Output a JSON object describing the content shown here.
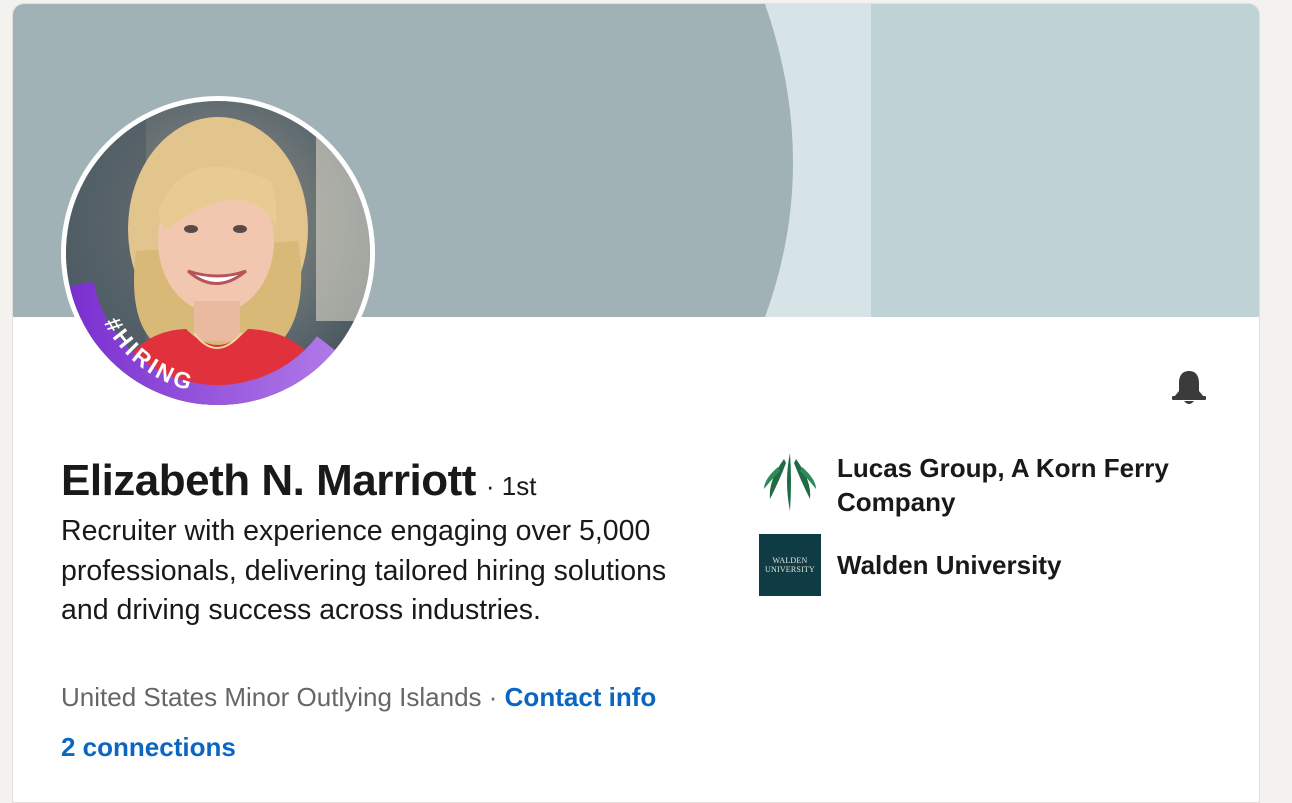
{
  "profile": {
    "name": "Elizabeth N. Marriott",
    "degree": "· 1st",
    "headline": "Recruiter with experience engaging over 5,000 professionals, delivering tailored hiring solutions and driving success across industries.",
    "location": "United States Minor Outlying Islands",
    "separator": " · ",
    "contact_info": "Contact info",
    "connections": "2 connections",
    "hiring_badge": "#HIRING"
  },
  "organizations": [
    {
      "name": "Lucas Group, A Korn Ferry Company",
      "logo_icon": "lucas-group-logo"
    },
    {
      "name": "Walden University",
      "logo_icon": "walden-university-logo",
      "logo_text": [
        "WALDEN",
        "UNIVERSITY"
      ]
    }
  ],
  "icons": {
    "bell": "bell-icon"
  },
  "colors": {
    "banner_dark": "#a0b2b6",
    "banner_mid": "#d7e4e7",
    "banner_light": "#bfd3d7",
    "link": "#0a66c2",
    "hiring_ring": "#8b3fd9",
    "walden_bg": "#0f3b45",
    "lucas_green": "#1e6b45"
  }
}
